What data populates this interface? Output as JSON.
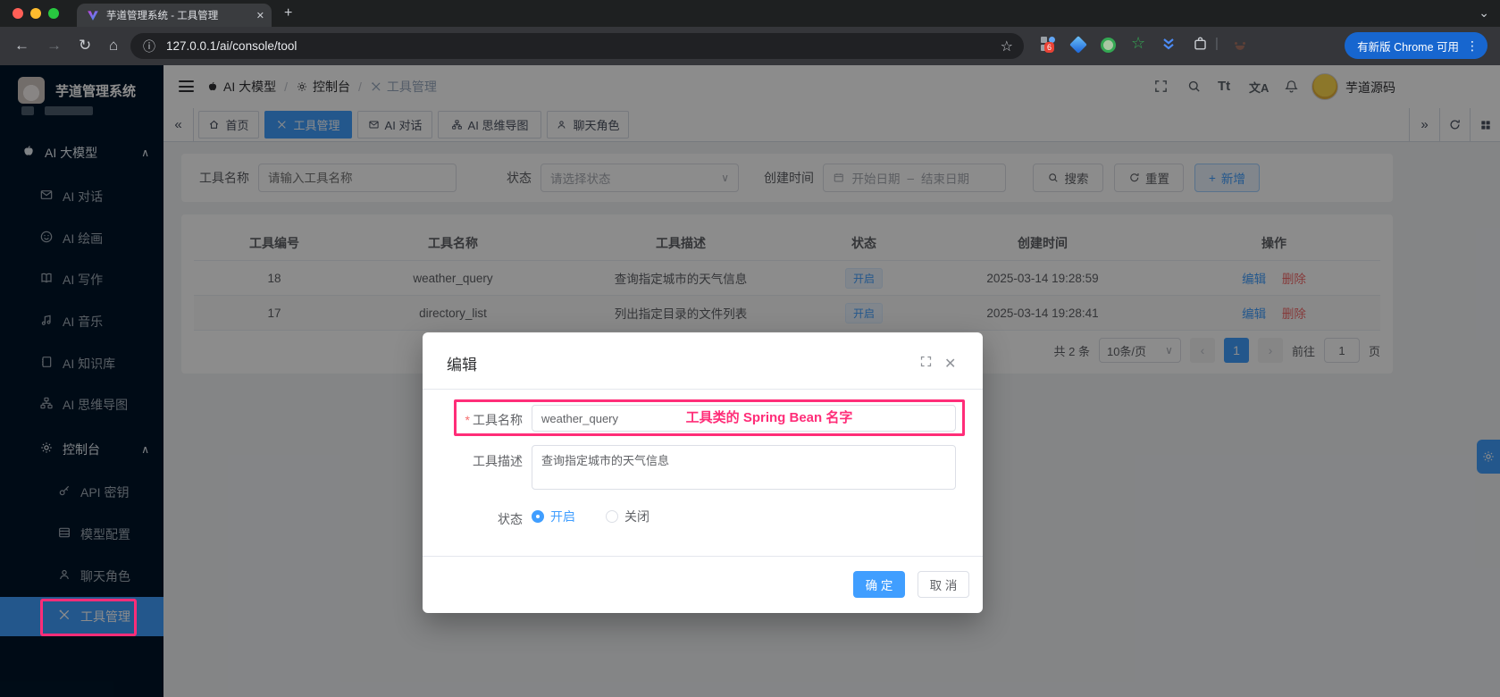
{
  "colors": {
    "primary": "#409eff",
    "danger": "#f56c6c",
    "annotation_pink": "#ff2d78",
    "sidebar_bg": "#001529",
    "chrome_dark": "#1e2021",
    "toolbar_dark": "#35363a",
    "update_pill_blue": "#1766cf"
  },
  "icons": {
    "back": "←",
    "forward": "→",
    "reload": "↻",
    "info": "ⓘ",
    "star": "☆",
    "new_tab": "+",
    "tab_search": "⌄",
    "close": "✕",
    "kebab": "⋮",
    "collapse": "«",
    "expand": "»",
    "select_arrow": "∨",
    "menu_arrow_up": "∧",
    "prev": "‹",
    "next": "›",
    "required": "*",
    "font_size": "Tt",
    "translate": "文A",
    "breadcrumb_sep": "/"
  },
  "browser": {
    "tab_title": "芋道管理系统 - 工具管理",
    "url": "127.0.0.1/ai/console/tool",
    "update_label": "有新版 Chrome 可用",
    "ext_badge": "6"
  },
  "sidebar": {
    "logo_title": "芋道管理系统",
    "items": [
      {
        "label": "AI 大模型",
        "icon": "apple-icon"
      },
      {
        "label": "AI 对话",
        "icon": "mail-icon"
      },
      {
        "label": "AI 绘画",
        "icon": "smile-icon"
      },
      {
        "label": "AI 写作",
        "icon": "book-icon"
      },
      {
        "label": "AI 音乐",
        "icon": "music-icon"
      },
      {
        "label": "AI 知识库",
        "icon": "notebook-icon"
      },
      {
        "label": "AI 思维导图",
        "icon": "sitemap-icon"
      },
      {
        "label": "控制台",
        "icon": "gear-icon"
      },
      {
        "label": "API 密钥",
        "icon": "key-icon"
      },
      {
        "label": "模型配置",
        "icon": "abacus-icon"
      },
      {
        "label": "聊天角色",
        "icon": "person-icon"
      },
      {
        "label": "工具管理",
        "icon": "tools-icon"
      }
    ]
  },
  "header": {
    "breadcrumb": [
      {
        "label": "AI 大模型"
      },
      {
        "label": "控制台"
      },
      {
        "label": "工具管理"
      }
    ],
    "user_name": "芋道源码"
  },
  "tabs": {
    "items": [
      {
        "label": "首页"
      },
      {
        "label": "工具管理"
      },
      {
        "label": "AI 对话"
      },
      {
        "label": "AI 思维导图"
      },
      {
        "label": "聊天角色"
      }
    ]
  },
  "filter": {
    "name_label": "工具名称",
    "name_placeholder": "请输入工具名称",
    "status_label": "状态",
    "status_placeholder": "请选择状态",
    "date_label": "创建时间",
    "date_start_placeholder": "开始日期",
    "date_separator": "–",
    "date_end_placeholder": "结束日期",
    "search_label": "搜索",
    "reset_label": "重置",
    "add_label": "新增"
  },
  "table": {
    "headers": [
      "工具编号",
      "工具名称",
      "工具描述",
      "状态",
      "创建时间",
      "操作"
    ],
    "rows": [
      {
        "id": "18",
        "name": "weather_query",
        "description": "查询指定城市的天气信息",
        "status": "开启",
        "created_at": "2025-03-14 19:28:59"
      },
      {
        "id": "17",
        "name": "directory_list",
        "description": "列出指定目录的文件列表",
        "status": "开启",
        "created_at": "2025-03-14 19:28:41"
      }
    ],
    "edit_label": "编辑",
    "delete_label": "删除"
  },
  "pagination": {
    "total": "共 2 条",
    "page_size": "10条/页",
    "current_page": "1",
    "goto_label": "前往",
    "goto_value": "1",
    "unit_label": "页"
  },
  "modal": {
    "title": "编辑",
    "name_label": "工具名称",
    "name_value": "weather_query",
    "desc_label": "工具描述",
    "desc_value": "查询指定城市的天气信息",
    "status_label": "状态",
    "status_on": "开启",
    "status_off": "关闭",
    "confirm_label": "确 定",
    "cancel_label": "取 消"
  },
  "annotations": {
    "spring_bean_note": "工具类的 Spring Bean 名字"
  }
}
